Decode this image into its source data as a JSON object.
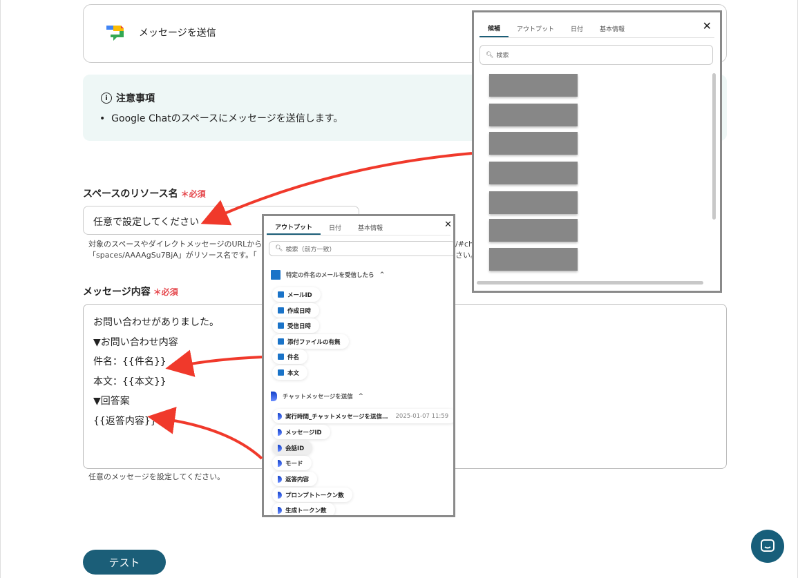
{
  "action_card": {
    "title": "メッセージを送信"
  },
  "notice": {
    "title": "注意事項",
    "items": [
      "Google Chatのスペースにメッセージを送信します。"
    ]
  },
  "space_field": {
    "label": "スペースのリソース名",
    "required": "＊必須",
    "value": "任意で設定してください",
    "help_line1": "対象のスペースやダイレクトメッセージのURLから",
    "help_line1_end": "/#ch",
    "help_line2": "「spaces/AAAAgSu7BjA」がリソース名です。「",
    "help_line2_end": "さい。"
  },
  "message_field": {
    "label": "メッセージ内容",
    "required": "＊必須",
    "value": "お問い合わせがありました。\n▼お問い合わせ内容\n件名：{{件名}}\n本文：{{本文}}\n▼回答案\n{{返答内容}}",
    "help": "任意のメッセージを設定してください。"
  },
  "test_button": "テスト",
  "popup_candidates": {
    "tabs": [
      "候補",
      "アウトプット",
      "日付",
      "基本情報"
    ],
    "search_placeholder": "検索"
  },
  "popup_output": {
    "tabs": [
      "アウトプット",
      "日付",
      "基本情報"
    ],
    "search_placeholder": "検索（前方一致）",
    "sections": [
      {
        "title": "特定の件名のメールを受信したら",
        "items": [
          "メールID",
          "作成日時",
          "受信日時",
          "添付ファイルの有無",
          "件名",
          "本文"
        ]
      },
      {
        "title": "チャットメッセージを送信",
        "items": [
          "実行時間_チャットメッセージを送信…",
          "メッセージID",
          "会話ID",
          "モード",
          "返答内容",
          "プロンプトトークン数",
          "生成トークン数"
        ],
        "first_value": "2025-01-07 11:59"
      }
    ]
  },
  "colors": {
    "accent": "#1b5e78",
    "required": "#e5484d",
    "arrow": "#f0392b"
  }
}
